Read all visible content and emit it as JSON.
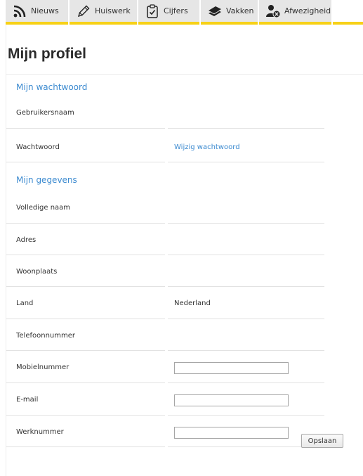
{
  "tabs": [
    {
      "label": "Nieuws",
      "icon": "rss-icon"
    },
    {
      "label": "Huiswerk",
      "icon": "pencil-icon"
    },
    {
      "label": "Cijfers",
      "icon": "checklist-icon"
    },
    {
      "label": "Vakken",
      "icon": "books-icon"
    },
    {
      "label": "Afwezigheid",
      "icon": "user-absent-icon"
    }
  ],
  "colors": {
    "tab_accent": "#f7d117",
    "link": "#3d8bd0",
    "tab_bg": "#e6e6e6"
  },
  "page": {
    "title": "Mijn profiel"
  },
  "password_section": {
    "heading": "Mijn wachtwoord",
    "username_label": "Gebruikersnaam",
    "username_value": "",
    "password_label": "Wachtwoord",
    "password_link": "Wijzig wachtwoord"
  },
  "details_section": {
    "heading": "Mijn gegevens",
    "full_name_label": "Volledige naam",
    "address_label": "Adres",
    "city_label": "Woonplaats",
    "country_label": "Land",
    "country_value": "Nederland",
    "phone_label": "Telefoonnummer",
    "mobile_label": "Mobielnummer",
    "mobile_value": "",
    "email_label": "E-mail",
    "email_value": "",
    "work_label": "Werknummer",
    "work_value": ""
  },
  "save_label": "Opslaan"
}
